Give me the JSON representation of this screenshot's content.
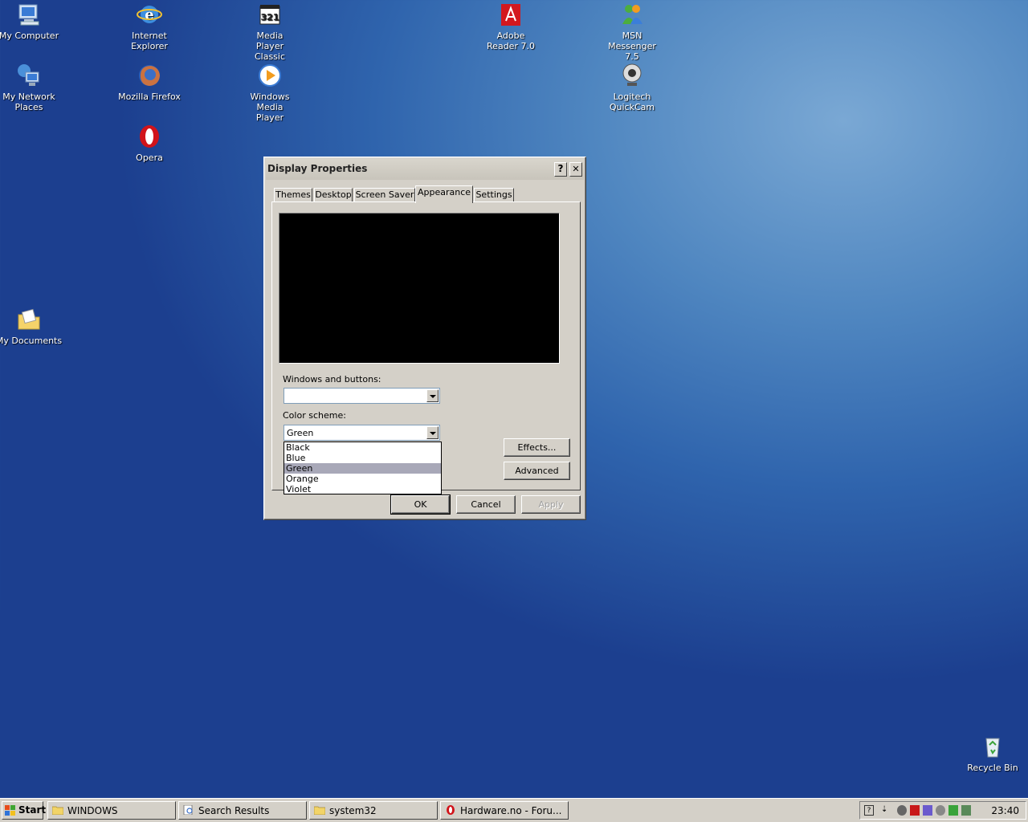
{
  "desktop_icons": {
    "my_computer": "My Computer",
    "internet_explorer": "Internet Explorer",
    "media_player_classic": "Media Player Classic",
    "adobe_reader": "Adobe Reader 7.0",
    "msn_messenger": "MSN Messenger 7.5",
    "my_network_places": "My Network Places",
    "mozilla_firefox": "Mozilla Firefox",
    "windows_media_player": "Windows Media Player",
    "logitech_quickcam": "Logitech QuickCam",
    "opera": "Opera",
    "my_documents": "My Documents",
    "recycle_bin": "Recycle Bin"
  },
  "dialog": {
    "title": "Display Properties",
    "help_button": "?",
    "close_button": "✕",
    "tabs": [
      "Themes",
      "Desktop",
      "Screen Saver",
      "Appearance",
      "Settings"
    ],
    "active_tab": "Appearance",
    "windows_and_buttons_label": "Windows and buttons:",
    "windows_and_buttons_value": "",
    "color_scheme_label": "Color scheme:",
    "color_scheme_value": "Green",
    "color_scheme_options": [
      "Black",
      "Blue",
      "Green",
      "Orange",
      "Violet"
    ],
    "effects_button": "Effects...",
    "advanced_button": "Advanced",
    "ok_button": "OK",
    "cancel_button": "Cancel",
    "apply_button": "Apply"
  },
  "taskbar": {
    "start": "Start",
    "tasks": [
      "WINDOWS",
      "Search Results",
      "system32",
      "Hardware.no - Foru..."
    ],
    "clock": "23:40"
  },
  "colors": {
    "desktop_blue": "#2f64ad",
    "dialog_face": "#d4d0c8",
    "preview_black": "#000000",
    "selected_option": "#a8a8b8"
  }
}
